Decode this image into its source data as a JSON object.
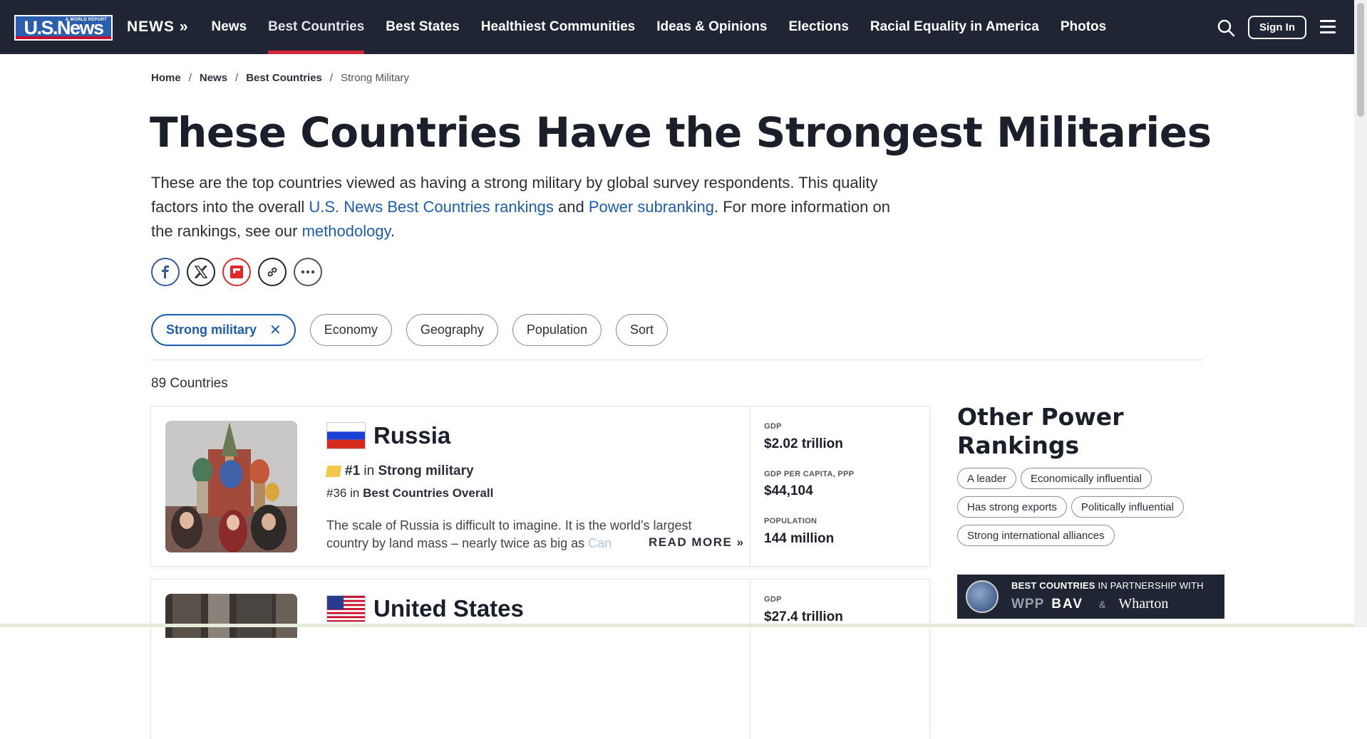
{
  "nav": {
    "logo_text": "U.S.News",
    "logo_sub": "& WORLD REPORT",
    "section_label": "NEWS »",
    "items": [
      {
        "label": "News"
      },
      {
        "label": "Best Countries",
        "active": true
      },
      {
        "label": "Best States"
      },
      {
        "label": "Healthiest Communities"
      },
      {
        "label": "Ideas & Opinions"
      },
      {
        "label": "Elections"
      },
      {
        "label": "Racial Equality in America"
      },
      {
        "label": "Photos"
      }
    ],
    "signin_label": "Sign In"
  },
  "breadcrumb": [
    "Home",
    "News",
    "Best Countries",
    "Strong Military"
  ],
  "title": "These Countries Have the Strongest Militaries",
  "intro": {
    "text1": "These are the top countries viewed as having a strong military by global survey respondents. This quality factors into the overall ",
    "link1": "U.S. News Best Countries rankings",
    "text2": " and ",
    "link2": "Power subranking",
    "text3": ". For more information on the rankings, see our ",
    "link3": "methodology",
    "text4": "."
  },
  "filters": {
    "active": "Strong military",
    "others": [
      "Economy",
      "Geography",
      "Population",
      "Sort"
    ]
  },
  "count": "89 Countries",
  "countries": [
    {
      "name": "Russia",
      "rank_primary": "#1",
      "rank_primary_in": "in",
      "rank_primary_category": "Strong military",
      "rank_secondary": "#36",
      "rank_secondary_in": "in",
      "rank_secondary_category": "Best Countries Overall",
      "description": "The scale of Russia is difficult to imagine. It is the world’s largest country by land mass – nearly twice as big as ",
      "description_fade": "Can",
      "read_more": "READ MORE »",
      "gdp_label": "GDP",
      "gdp": "$2.02 trillion",
      "gdp_pc_label": "GDP PER CAPITA, PPP",
      "gdp_pc": "$44,104",
      "pop_label": "POPULATION",
      "population": "144 million"
    },
    {
      "name": "United States",
      "gdp_label": "GDP",
      "gdp": "$27.4 trillion"
    }
  ],
  "sidebar": {
    "title": "Other Power Rankings",
    "tags": [
      "A leader",
      "Economically influential",
      "Has strong exports",
      "Politically influential",
      "Strong international alliances"
    ],
    "partner_title_bold": "BEST COUNTRIES",
    "partner_title_rest": " IN PARTNERSHIP WITH",
    "partner_logos": [
      "WPP",
      "BAV",
      "&",
      "Wharton"
    ]
  },
  "colors": {
    "nav_bg": "#1f2532",
    "accent_red": "#d6243a",
    "link_blue": "#1c5db0"
  }
}
